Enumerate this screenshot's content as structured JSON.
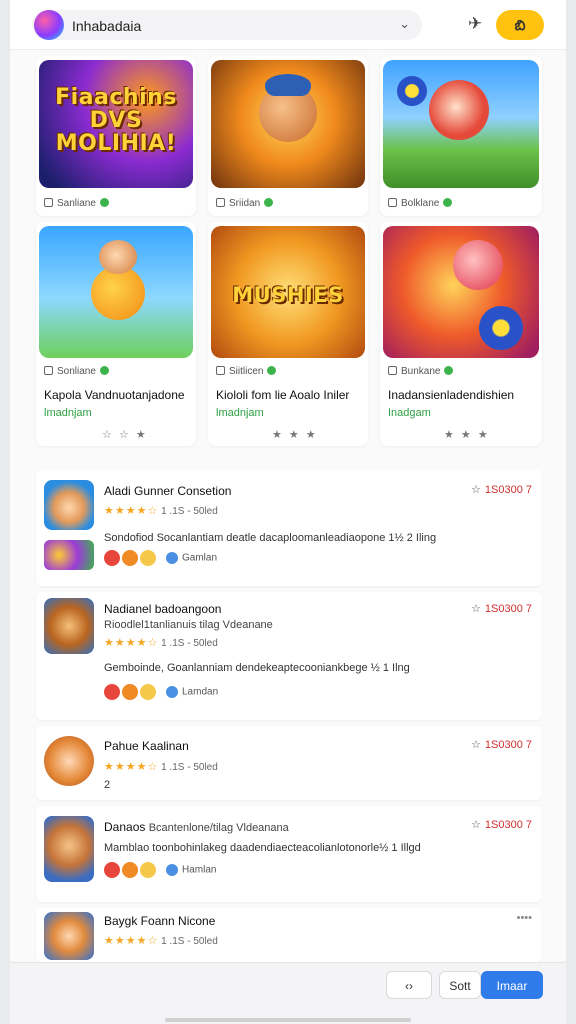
{
  "header": {
    "search_text": "Inhabadaia",
    "chevron": "⌄",
    "icons": [
      "app-logo-icon",
      "chevron-down-icon",
      "share-icon",
      "profile-icon"
    ],
    "share_glyph": "✈",
    "profile_label": "బి"
  },
  "grid": [
    {
      "tag": "Sanliane",
      "thumb_text": "Fiaachins DVS MOLIHIA!",
      "title": "",
      "subtitle": "",
      "stars": ""
    },
    {
      "tag": "Sriidan",
      "thumb_text": "",
      "title": "",
      "subtitle": "",
      "stars": ""
    },
    {
      "tag": "Bolklane",
      "thumb_text": "",
      "title": "",
      "subtitle": "",
      "stars": ""
    },
    {
      "tag": "Sonliane",
      "thumb_text": "",
      "title": "Kapola Vandnuotanjadone",
      "subtitle": "lmadnjam",
      "stars": "☆ ☆ ★"
    },
    {
      "tag": "Siitlicen",
      "thumb_text": "MUSHIES",
      "title": "Kiololi fom lie Aoalo Iniler",
      "subtitle": "lmadnjam",
      "stars": "★ ★ ★"
    },
    {
      "tag": "Bunkane",
      "thumb_text": "",
      "title": "Inadansienladendishien",
      "subtitle": "Inadgam",
      "stars": "★ ★ ★"
    }
  ],
  "list": [
    {
      "title": "Aladi Gunner Consetion",
      "subtitle": "",
      "stars": "★★★★☆",
      "rating": "1 .1S - 50led",
      "price": "1S0300 7",
      "desc": "Sondofiod Socanlantiam deatle dacaploomanleadiaopone 1½ 2 Iling",
      "developer": "Gamlan"
    },
    {
      "title": "Nadianel badoangoon",
      "subtitle": "Rioodlel1tanlianuis tilag Vdeanane",
      "stars": "★★★★☆",
      "rating": "1 .1S - 50led",
      "price": "1S0300 7",
      "desc": "Gemboinde, Goanlanniam dendekeaptecooniankbege ½ 1 Ilng",
      "developer": "Lamdan"
    },
    {
      "title": "Pahue Kaalinan",
      "subtitle": "",
      "stars": "★★★★☆",
      "rating": "1 .1S - 50led",
      "price": "1S0300 7",
      "desc": "2",
      "developer": ""
    },
    {
      "title": "Danaos",
      "subtitle": "Bcantenlone/tilag Vldeanana",
      "stars": "",
      "rating": "",
      "price": "1S0300 7",
      "desc": "Mamblao toonbohinlakeg daadendiaecteacolianlotonorle½ 1 Illgd",
      "developer": "Hamlan"
    },
    {
      "title": "Baygk Foann Nicone",
      "subtitle": "",
      "stars": "★★★★☆",
      "rating": "1 .1S - 50led",
      "price": "••••",
      "desc": "",
      "developer": ""
    }
  ],
  "footer": {
    "back_label": "‹›",
    "sort_label": "Sott",
    "install_label": "Imaar"
  }
}
